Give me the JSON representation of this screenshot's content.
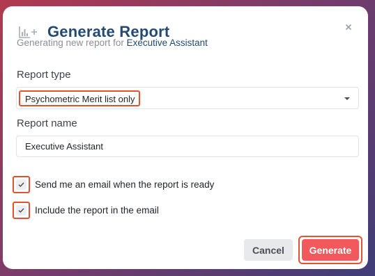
{
  "dialog": {
    "title": "Generate Report",
    "subtitle_prefix": "Generating new report for",
    "subtitle_role": "Executive Assistant",
    "title_icon": "bar-chart-plus-icon",
    "close_icon": "close-icon"
  },
  "form": {
    "report_type_label": "Report type",
    "report_type_value": "Psychometric Merit list only",
    "report_name_label": "Report name",
    "report_name_value": "Executive Assistant",
    "checkboxes": [
      {
        "label": "Send me an email when the report is ready",
        "checked": true
      },
      {
        "label": "Include the report in the email",
        "checked": true
      }
    ]
  },
  "actions": {
    "cancel_label": "Cancel",
    "generate_label": "Generate"
  },
  "colors": {
    "title": "#234a73",
    "accent": "#f2595d",
    "highlight_border": "#e3522f",
    "background_gradient": [
      "#b13a4f",
      "#7a3b6a",
      "#3f3d78"
    ]
  }
}
